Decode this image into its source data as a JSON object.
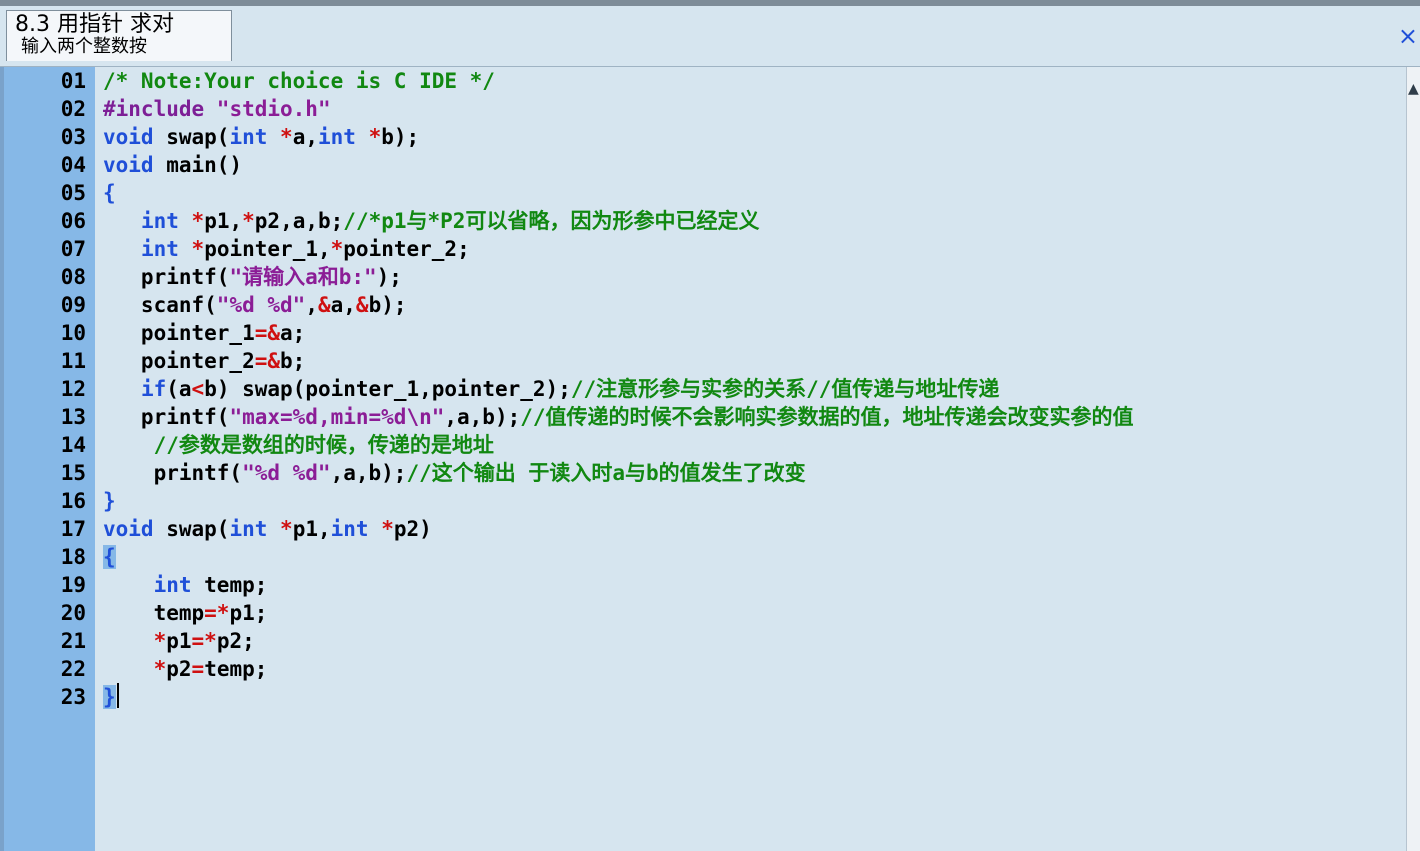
{
  "tab": {
    "title_line1": "8.3 用指针 求对",
    "title_line2": "输入两个整数按",
    "close_glyph": "×"
  },
  "editor": {
    "lines": [
      {
        "no": "01",
        "segments": [
          {
            "t": "/* Note:Your choice is C IDE */",
            "c": "comment"
          }
        ]
      },
      {
        "no": "02",
        "segments": [
          {
            "t": "#include ",
            "c": "pre"
          },
          {
            "t": "\"stdio.h\"",
            "c": "str"
          }
        ]
      },
      {
        "no": "03",
        "segments": [
          {
            "t": "void",
            "c": "kw"
          },
          {
            "t": " swap(",
            "c": "plain"
          },
          {
            "t": "int",
            "c": "kw"
          },
          {
            "t": " ",
            "c": "plain"
          },
          {
            "t": "*",
            "c": "op"
          },
          {
            "t": "a,",
            "c": "plain"
          },
          {
            "t": "int",
            "c": "kw"
          },
          {
            "t": " ",
            "c": "plain"
          },
          {
            "t": "*",
            "c": "op"
          },
          {
            "t": "b);",
            "c": "plain"
          }
        ]
      },
      {
        "no": "04",
        "segments": [
          {
            "t": "void",
            "c": "kw"
          },
          {
            "t": " main()",
            "c": "plain"
          }
        ]
      },
      {
        "no": "05",
        "segments": [
          {
            "t": "{",
            "c": "brace"
          }
        ]
      },
      {
        "no": "06",
        "segments": [
          {
            "t": "   ",
            "c": "plain"
          },
          {
            "t": "int",
            "c": "kw"
          },
          {
            "t": " ",
            "c": "plain"
          },
          {
            "t": "*",
            "c": "op"
          },
          {
            "t": "p1,",
            "c": "plain"
          },
          {
            "t": "*",
            "c": "op"
          },
          {
            "t": "p2,a,b;",
            "c": "plain"
          },
          {
            "t": "//*p1与*P2可以省略，因为形参中已经定义",
            "c": "comment"
          }
        ]
      },
      {
        "no": "07",
        "segments": [
          {
            "t": "   ",
            "c": "plain"
          },
          {
            "t": "int",
            "c": "kw"
          },
          {
            "t": " ",
            "c": "plain"
          },
          {
            "t": "*",
            "c": "op"
          },
          {
            "t": "pointer_1,",
            "c": "plain"
          },
          {
            "t": "*",
            "c": "op"
          },
          {
            "t": "pointer_2;",
            "c": "plain"
          }
        ]
      },
      {
        "no": "08",
        "segments": [
          {
            "t": "   printf(",
            "c": "plain"
          },
          {
            "t": "\"请输入a和b:\"",
            "c": "str"
          },
          {
            "t": ");",
            "c": "plain"
          }
        ]
      },
      {
        "no": "09",
        "segments": [
          {
            "t": "   scanf(",
            "c": "plain"
          },
          {
            "t": "\"%d %d\"",
            "c": "str"
          },
          {
            "t": ",",
            "c": "plain"
          },
          {
            "t": "&",
            "c": "op"
          },
          {
            "t": "a,",
            "c": "plain"
          },
          {
            "t": "&",
            "c": "op"
          },
          {
            "t": "b);",
            "c": "plain"
          }
        ]
      },
      {
        "no": "10",
        "segments": [
          {
            "t": "   pointer_1",
            "c": "plain"
          },
          {
            "t": "=&",
            "c": "op"
          },
          {
            "t": "a;",
            "c": "plain"
          }
        ]
      },
      {
        "no": "11",
        "segments": [
          {
            "t": "   pointer_2",
            "c": "plain"
          },
          {
            "t": "=&",
            "c": "op"
          },
          {
            "t": "b;",
            "c": "plain"
          }
        ]
      },
      {
        "no": "12",
        "segments": [
          {
            "t": "   ",
            "c": "plain"
          },
          {
            "t": "if",
            "c": "kw"
          },
          {
            "t": "(a",
            "c": "plain"
          },
          {
            "t": "<",
            "c": "op"
          },
          {
            "t": "b) swap(pointer_1,pointer_2);",
            "c": "plain"
          },
          {
            "t": "//注意形参与实参的关系//值传递与地址传递",
            "c": "comment"
          }
        ]
      },
      {
        "no": "13",
        "segments": [
          {
            "t": "   printf(",
            "c": "plain"
          },
          {
            "t": "\"max=%d,min=%d\\n\"",
            "c": "str"
          },
          {
            "t": ",a,b);",
            "c": "plain"
          },
          {
            "t": "//值传递的时候不会影响实参数据的值，地址传递会改变实参的值",
            "c": "comment"
          }
        ]
      },
      {
        "no": "14",
        "segments": [
          {
            "t": "    ",
            "c": "plain"
          },
          {
            "t": "//参数是数组的时候，传递的是地址",
            "c": "comment"
          }
        ]
      },
      {
        "no": "15",
        "segments": [
          {
            "t": "    printf(",
            "c": "plain"
          },
          {
            "t": "\"%d %d\"",
            "c": "str"
          },
          {
            "t": ",a,b);",
            "c": "plain"
          },
          {
            "t": "//这个输出 于读入时a与b的值发生了改变",
            "c": "comment"
          }
        ]
      },
      {
        "no": "16",
        "segments": [
          {
            "t": "}",
            "c": "brace"
          }
        ]
      },
      {
        "no": "17",
        "segments": [
          {
            "t": "void",
            "c": "kw"
          },
          {
            "t": " swap(",
            "c": "plain"
          },
          {
            "t": "int",
            "c": "kw"
          },
          {
            "t": " ",
            "c": "plain"
          },
          {
            "t": "*",
            "c": "op"
          },
          {
            "t": "p1,",
            "c": "plain"
          },
          {
            "t": "int",
            "c": "kw"
          },
          {
            "t": " ",
            "c": "plain"
          },
          {
            "t": "*",
            "c": "op"
          },
          {
            "t": "p2)",
            "c": "plain"
          }
        ]
      },
      {
        "no": "18",
        "segments": [
          {
            "t": "{",
            "c": "brace"
          }
        ]
      },
      {
        "no": "19",
        "segments": [
          {
            "t": "    ",
            "c": "plain"
          },
          {
            "t": "int",
            "c": "kw"
          },
          {
            "t": " temp;",
            "c": "plain"
          }
        ]
      },
      {
        "no": "20",
        "segments": [
          {
            "t": "    temp",
            "c": "plain"
          },
          {
            "t": "=*",
            "c": "op"
          },
          {
            "t": "p1;",
            "c": "plain"
          }
        ]
      },
      {
        "no": "21",
        "segments": [
          {
            "t": "    ",
            "c": "plain"
          },
          {
            "t": "*",
            "c": "op"
          },
          {
            "t": "p1",
            "c": "plain"
          },
          {
            "t": "=*",
            "c": "op"
          },
          {
            "t": "p2;",
            "c": "plain"
          }
        ]
      },
      {
        "no": "22",
        "segments": [
          {
            "t": "    ",
            "c": "plain"
          },
          {
            "t": "*",
            "c": "op"
          },
          {
            "t": "p2",
            "c": "plain"
          },
          {
            "t": "=",
            "c": "op"
          },
          {
            "t": "temp;",
            "c": "plain"
          }
        ]
      },
      {
        "no": "23",
        "segments": [
          {
            "t": "}",
            "c": "brace"
          }
        ]
      }
    ]
  },
  "scrollbar": {
    "arrow_glyph": "▲"
  }
}
